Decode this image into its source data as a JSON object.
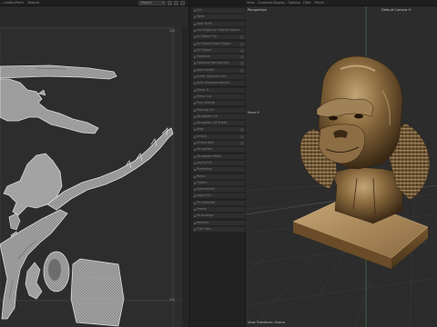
{
  "uv_editor": {
    "menu": [
      "...olution",
      "Point",
      "Texture"
    ],
    "project_select": "Project",
    "tile_labels": {
      "top": "1.0",
      "bottom": "1.0"
    }
  },
  "tool_panel": {
    "buttons": [
      "Cut",
      "Weld",
      "Split To Fit",
      "Cut Edges to Original Seams",
      "UV Select Tip",
      "UV Select Seam Edges",
      "UV Select",
      "Optimize",
      "Optimize Horizontally",
      "Auto Unfold",
      "Invert Optimize Ctrl",
      "Auto Organize Islands",
      "Mirror U",
      "Mirror Cut",
      "Pack Islands",
      "Packing Ctrl",
      "Straighten UV",
      "Straighten All Shells",
      "Align",
      "Unfold",
      "Unfold Axis",
      "Straighten",
      "Straighten Mode",
      "Layout UV",
      "Normalize",
      "Relax",
      "Flatten",
      "Symmetrize",
      "Copy UVs",
      "Pin Selected",
      "Freeze",
      "Re-Arrange",
      "Reverse",
      "Trim Tiles"
    ],
    "checked_rows": [
      4,
      5,
      6,
      7,
      8,
      9,
      18,
      19,
      20
    ]
  },
  "viewport": {
    "menu": [
      "View",
      "Cameras",
      "Display",
      "Options",
      "Filter",
      "Panel"
    ],
    "label_view": "Perspective",
    "label_camera": "Default Camera ⟳",
    "label_tool": "Move ⟳",
    "footer": "View Transform: Scene"
  },
  "colors": {
    "uv_line": "#d6d6d6",
    "uv_fill": "#9a9a9a",
    "bronze_light": "#a98a5e",
    "bronze_dark": "#3d2c18",
    "grid_line": "#3a3a3a",
    "axis_green": "#5f9a6a"
  }
}
